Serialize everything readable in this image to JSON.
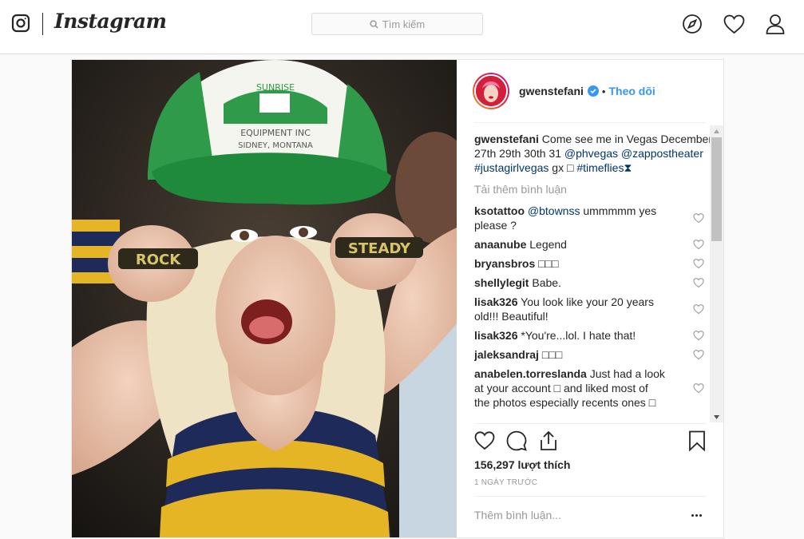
{
  "nav": {
    "wordmark": "Instagram",
    "search_placeholder": "Tìm kiếm",
    "icons": [
      "camera-logo-icon",
      "compass-icon",
      "heart-icon",
      "profile-icon"
    ]
  },
  "post": {
    "photo": {
      "cap_text_line1": "SUNRISE",
      "cap_text_line2": "EQUIPMENT INC",
      "cap_text_line3": "SIDNEY, MONTANA",
      "ring_left": "ROCK",
      "ring_right": "STEADY"
    },
    "header": {
      "username": "gwenstefani",
      "separator": "•",
      "follow_label": "Theo dõi"
    },
    "caption": {
      "username": "gwenstefani",
      "text": " Come see me in Vegas December 27th 29th 30th 31 ",
      "mention1": "@phvegas",
      "mention2": "@zappostheater",
      "hashtag1": "#justagirlvegas",
      "text2": " gx □ ",
      "hashtag2": "#timeflies⧗"
    },
    "load_more": "Tải thêm bình luận",
    "comments": [
      {
        "user": "ksotattoo",
        "mention": "@btownss",
        "text": " ummmmm yes please ?"
      },
      {
        "user": "anaanube",
        "mention": "",
        "text": " Legend"
      },
      {
        "user": "bryansbros",
        "mention": "",
        "text": " □□□"
      },
      {
        "user": "shellylegit",
        "mention": "",
        "text": " Babe."
      },
      {
        "user": "lisak326",
        "mention": "",
        "text": " You look like your 20 years old!!! Beautiful!"
      },
      {
        "user": "lisak326",
        "mention": "",
        "text": " *You're...lol. I hate that!"
      },
      {
        "user": "jaleksandraj",
        "mention": "",
        "text": " □□□"
      },
      {
        "user": "anabelen.torreslanda",
        "mention": "",
        "text": " Just had a look at your account □ and liked most of the photos especially recents ones □"
      }
    ],
    "likes": "156,297 lượt thích",
    "time": "1 NGÀY TRƯỚC",
    "add_comment_placeholder": "Thêm bình luận...",
    "colors": {
      "accent": "#3897f0",
      "link": "#003569",
      "muted": "#999999",
      "border": "#dbdbdb"
    }
  }
}
